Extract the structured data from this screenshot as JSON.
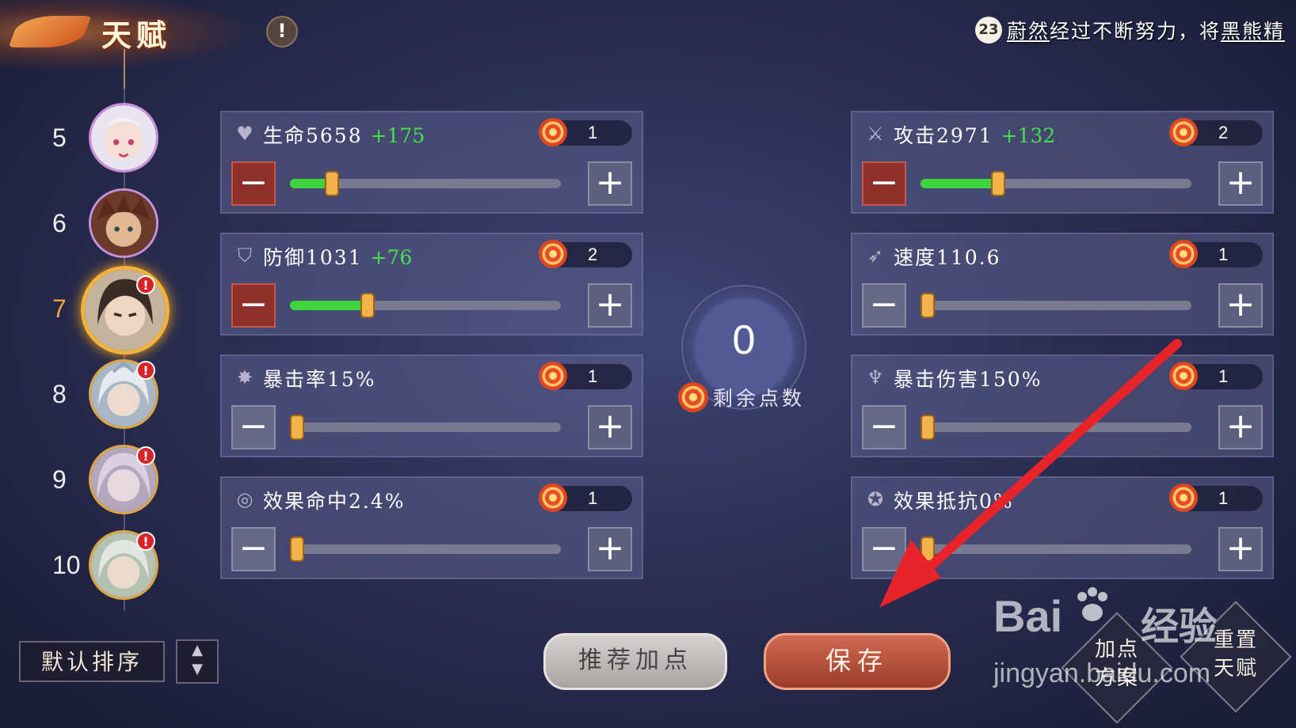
{
  "header": {
    "title": "天赋",
    "info_glyph": "!",
    "news_badge": "23",
    "news": {
      "player": "蔚然",
      "middle": "经过不断努力，将",
      "item": "黑熊精"
    }
  },
  "roster": {
    "items": [
      {
        "level": "5",
        "badge": ""
      },
      {
        "level": "6",
        "badge": ""
      },
      {
        "level": "7",
        "badge": "!",
        "selected": true
      },
      {
        "level": "8",
        "badge": "!"
      },
      {
        "level": "9",
        "badge": "!"
      },
      {
        "level": "10",
        "badge": "!"
      }
    ],
    "sort_label": "默认排序",
    "sort_icon": "up-down-arrows-icon"
  },
  "stats": {
    "hp": {
      "label": "生命5658",
      "bonus": "+175",
      "cost": "1",
      "level_fraction": 0.13,
      "minus_active": true,
      "icon": "heart-icon"
    },
    "atk": {
      "label": "攻击2971",
      "bonus": "+132",
      "cost": "2",
      "level_fraction": 0.26,
      "minus_active": true,
      "icon": "sword-icon"
    },
    "def": {
      "label": "防御1031",
      "bonus": "+76",
      "cost": "2",
      "level_fraction": 0.26,
      "minus_active": true,
      "icon": "shield-icon"
    },
    "spd": {
      "label": "速度110.6",
      "bonus": "",
      "cost": "1",
      "level_fraction": 0.0,
      "minus_active": false,
      "icon": "boot-icon"
    },
    "crit": {
      "label": "暴击率15%",
      "bonus": "",
      "cost": "1",
      "level_fraction": 0.0,
      "minus_active": false,
      "icon": "crit-icon"
    },
    "critdmg": {
      "label": "暴击伤害150%",
      "bonus": "",
      "cost": "1",
      "level_fraction": 0.0,
      "minus_active": false,
      "icon": "claw-icon"
    },
    "acc": {
      "label": "效果命中2.4%",
      "bonus": "",
      "cost": "1",
      "level_fraction": 0.0,
      "minus_active": false,
      "icon": "target-icon"
    },
    "res": {
      "label": "效果抵抗0%",
      "bonus": "",
      "cost": "1",
      "level_fraction": 0.0,
      "minus_active": false,
      "icon": "resist-icon"
    }
  },
  "center": {
    "points": "0",
    "label": "剩余点数"
  },
  "buttons": {
    "recommend": "推荐加点",
    "save": "保存",
    "plan_l1": "加点",
    "plan_l2": "方案",
    "reset_l1": "重置",
    "reset_l2": "天赋",
    "minus_glyph": "−",
    "plus_glyph": "+"
  },
  "watermark": {
    "brand": "Bai",
    "brand_cn": "经验",
    "url": "jingyan.baidu.com"
  },
  "colors": {
    "accent": "#f0a33a",
    "bonus": "#43e04a",
    "fill": "#3fd33f",
    "arrow": "#e8232a"
  }
}
